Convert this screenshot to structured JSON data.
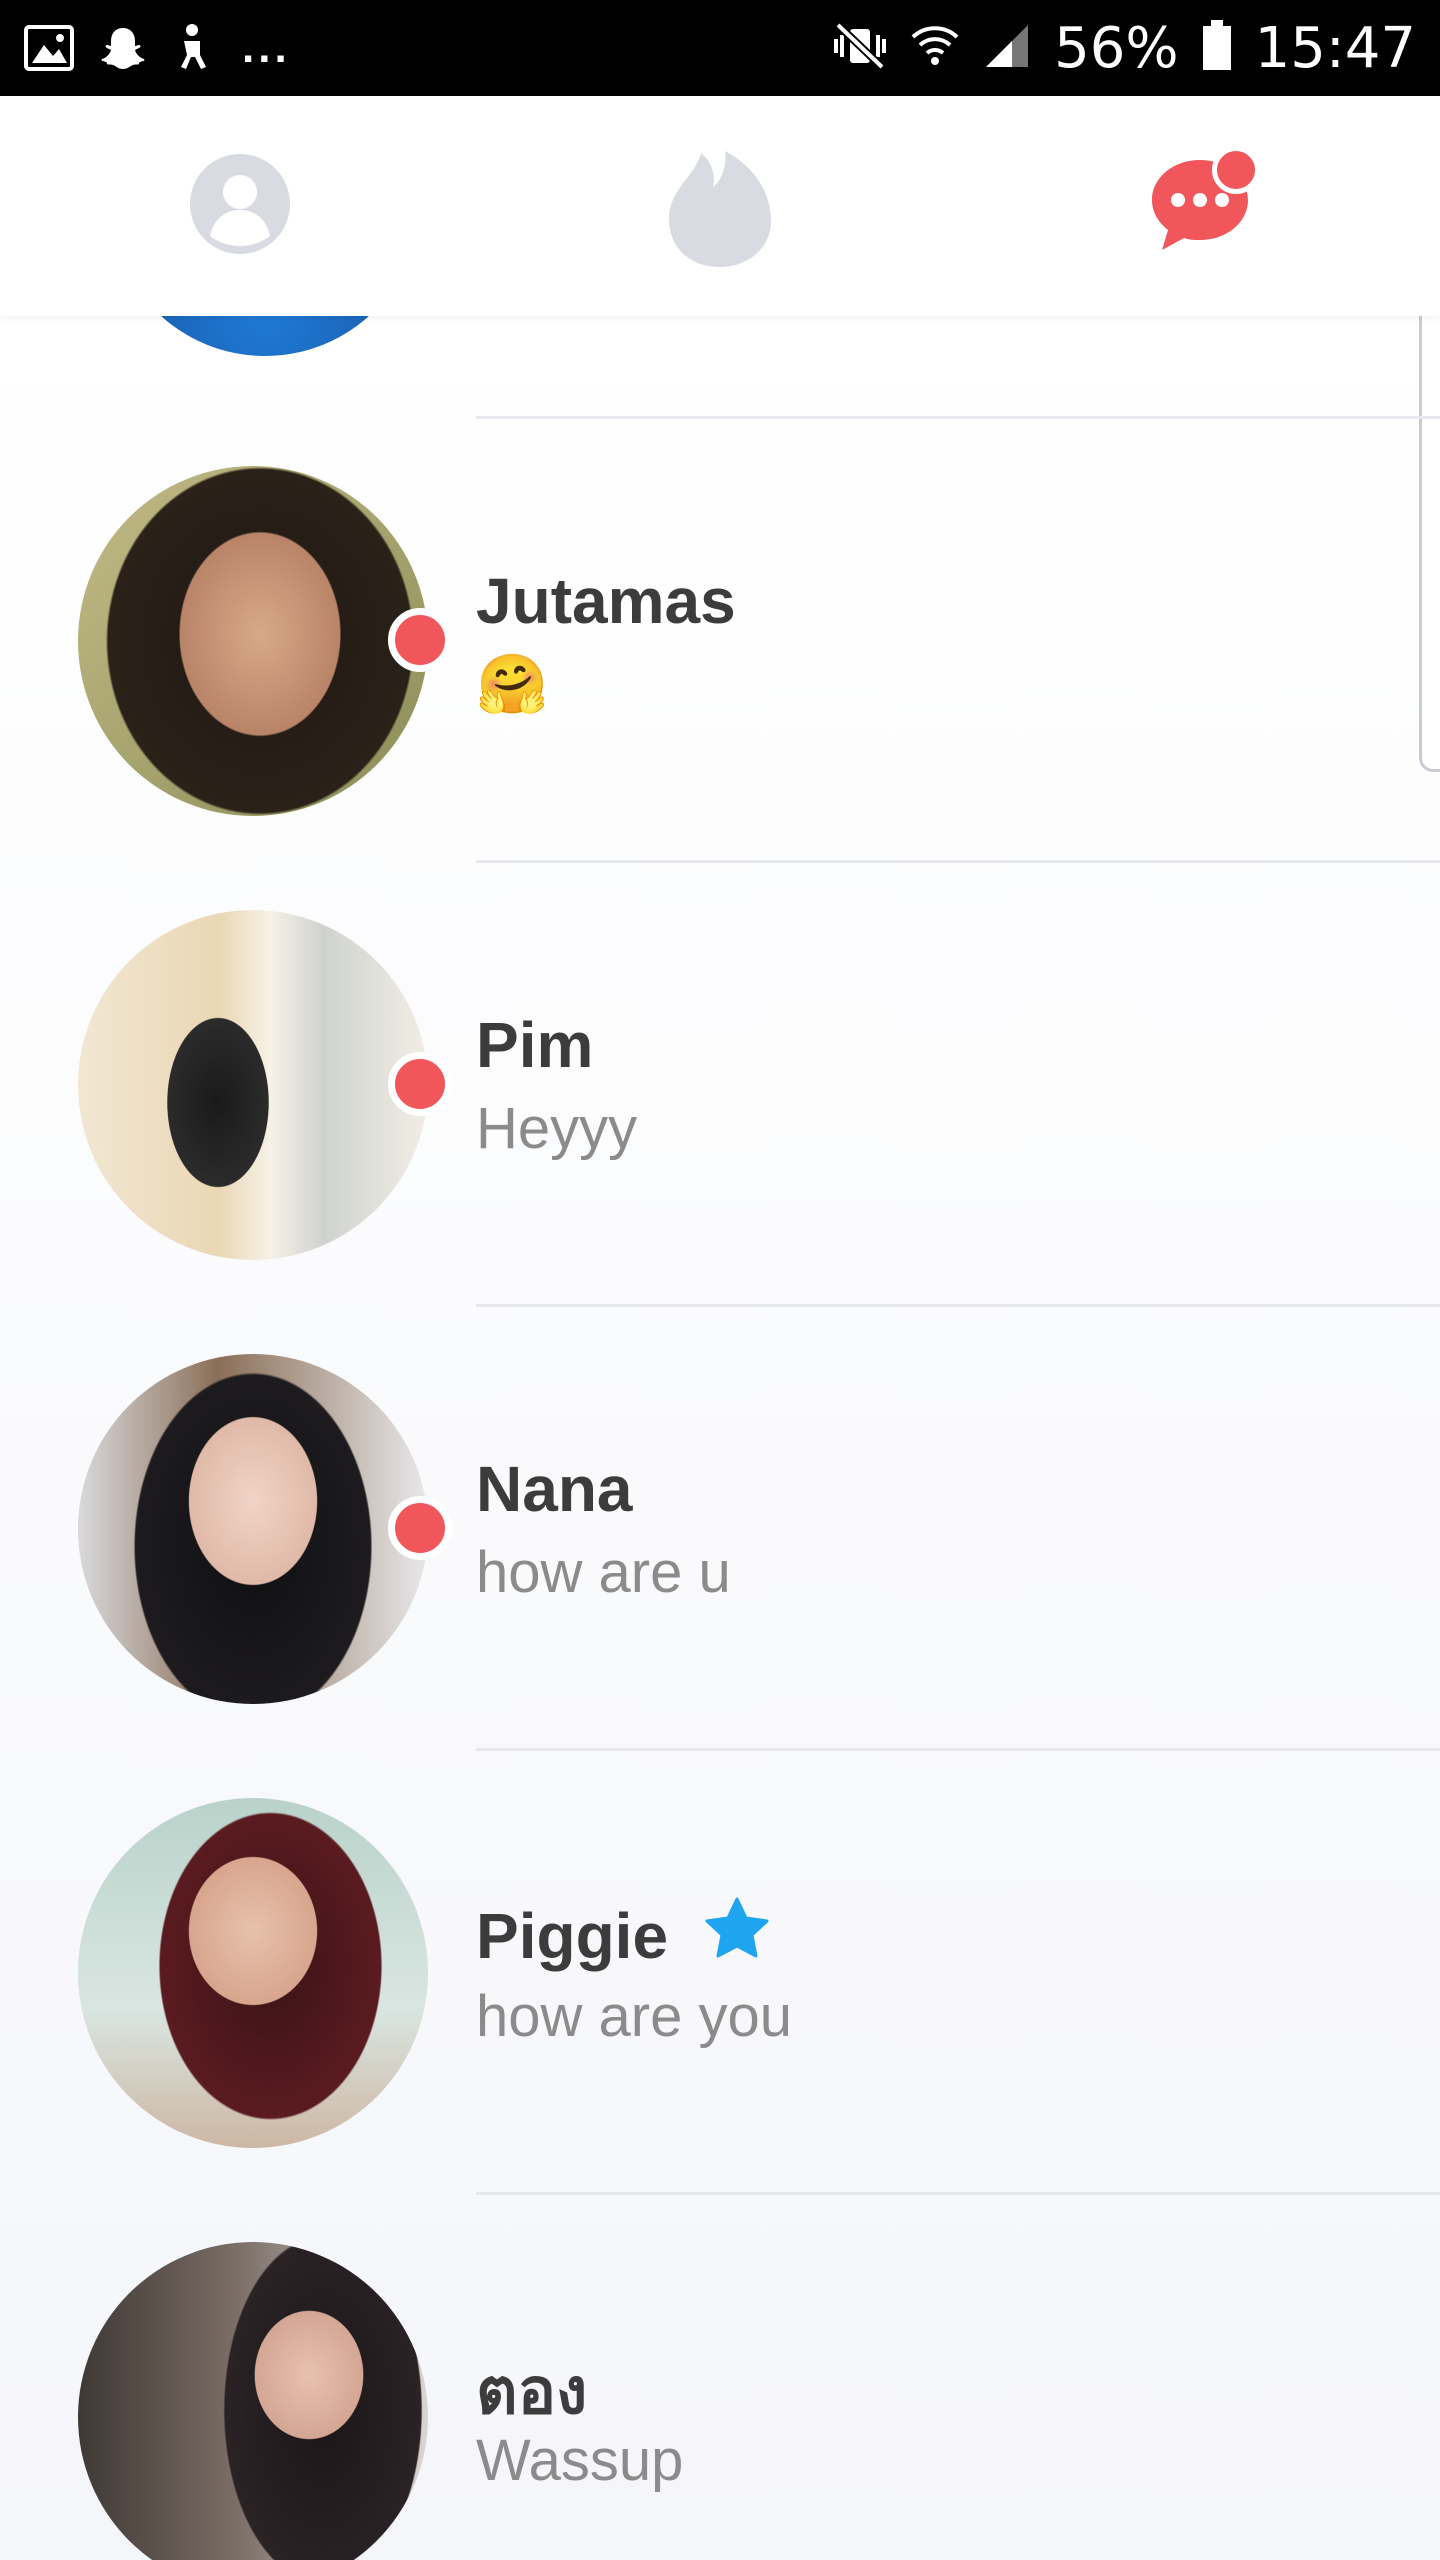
{
  "status_bar": {
    "battery_percent": "56%",
    "time": "15:47",
    "overflow": "..."
  },
  "nav": {
    "tabs": [
      {
        "icon": "profile-icon",
        "active": false
      },
      {
        "icon": "flame-icon",
        "active": false
      },
      {
        "icon": "messages-icon",
        "active": true,
        "has_notification": true
      }
    ]
  },
  "colors": {
    "accent": "#f0565a",
    "inactive_icon": "#d8dce2",
    "name_text": "#3c3c3c",
    "preview_text": "#8b8b8b",
    "star": "#1fa5f0"
  },
  "matches": [
    {
      "name": "Jutamas",
      "preview": "🤗",
      "unread": true,
      "super_like": false
    },
    {
      "name": "Pim",
      "preview": "Heyyy",
      "unread": true,
      "super_like": false
    },
    {
      "name": "Nana",
      "preview": "how are u",
      "unread": true,
      "super_like": false
    },
    {
      "name": "Piggie",
      "preview": "how are you",
      "unread": false,
      "super_like": true
    },
    {
      "name": "ตอง",
      "preview": "Wassup",
      "unread": false,
      "super_like": false
    }
  ]
}
